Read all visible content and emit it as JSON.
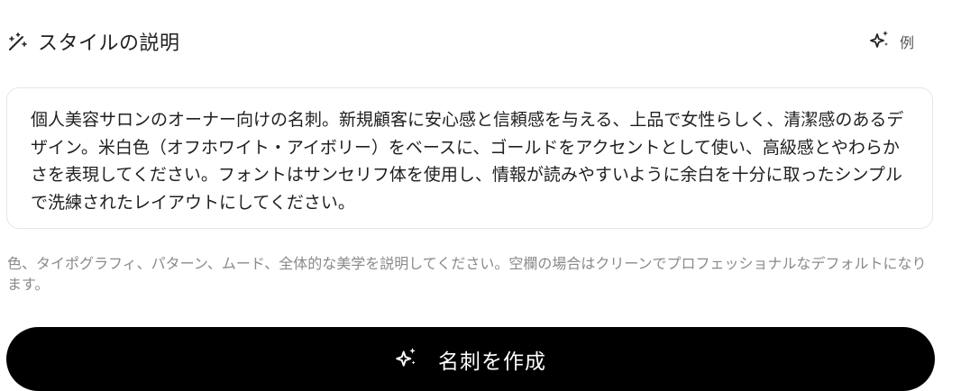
{
  "header": {
    "icon": "magic-wand-icon",
    "title": "スタイルの説明",
    "example": {
      "icon": "sparkles-icon",
      "label": "例"
    }
  },
  "description": {
    "value": "個人美容サロンのオーナー向けの名刺。新規顧客に安心感と信頼感を与える、上品で女性らしく、清潔感のあるデザイン。米白色（オフホワイト・アイボリー）をベースに、ゴールドをアクセントとして使い、高級感とやわらかさを表現してください。フォントはサンセリフ体を使用し、情報が読みやすいように余白を十分に取ったシンプルで洗練されたレイアウトにしてください。"
  },
  "help_text": "色、タイポグラフィ、パターン、ムード、全体的な美学を説明してください。空欄の場合はクリーンでプロフェッショナルなデフォルトになります。",
  "create_button": {
    "icon": "sparkles-icon",
    "label": "名刺を作成"
  },
  "colors": {
    "button_bg": "#000000",
    "button_text": "#ffffff",
    "help_text": "#8a8a8a",
    "border": "#e6e6e6"
  }
}
